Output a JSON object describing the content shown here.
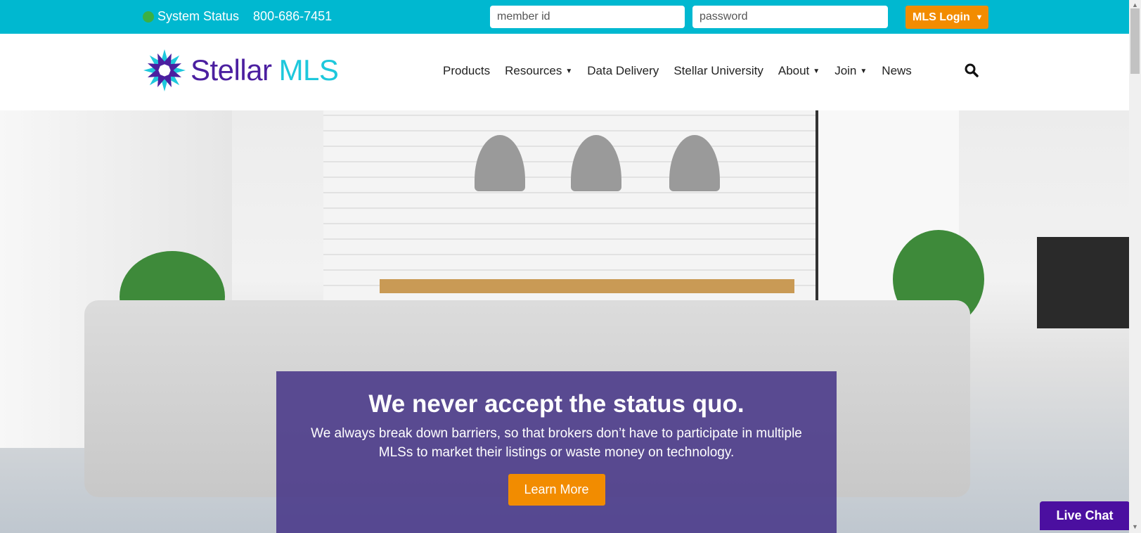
{
  "topbar": {
    "status_label": "System Status",
    "status_color": "#3cb043",
    "phone": "800-686-7451",
    "member_id_placeholder": "member id",
    "password_placeholder": "password",
    "login_label": "MLS Login",
    "login_caret": "▼"
  },
  "brand": {
    "name_part1": "Stellar",
    "name_part2": "MLS",
    "primary_color": "#4b1fa0",
    "accent_color": "#1ec8dc"
  },
  "nav": {
    "items": [
      {
        "label": "Products",
        "has_dropdown": false
      },
      {
        "label": "Resources",
        "has_dropdown": true
      },
      {
        "label": "Data Delivery",
        "has_dropdown": false
      },
      {
        "label": "Stellar University",
        "has_dropdown": false
      },
      {
        "label": "About",
        "has_dropdown": true
      },
      {
        "label": "Join",
        "has_dropdown": true
      },
      {
        "label": "News",
        "has_dropdown": false
      }
    ],
    "caret": "▼",
    "search_icon": "search-icon"
  },
  "hero": {
    "headline": "We never accept the status quo.",
    "subtext": "We always break down barriers, so that brokers don’t have to participate in multiple MLSs to market their listings or waste money on technology.",
    "cta_label": "Learn More",
    "cta_color": "#f28c00"
  },
  "live_chat": {
    "label": "Live Chat"
  }
}
